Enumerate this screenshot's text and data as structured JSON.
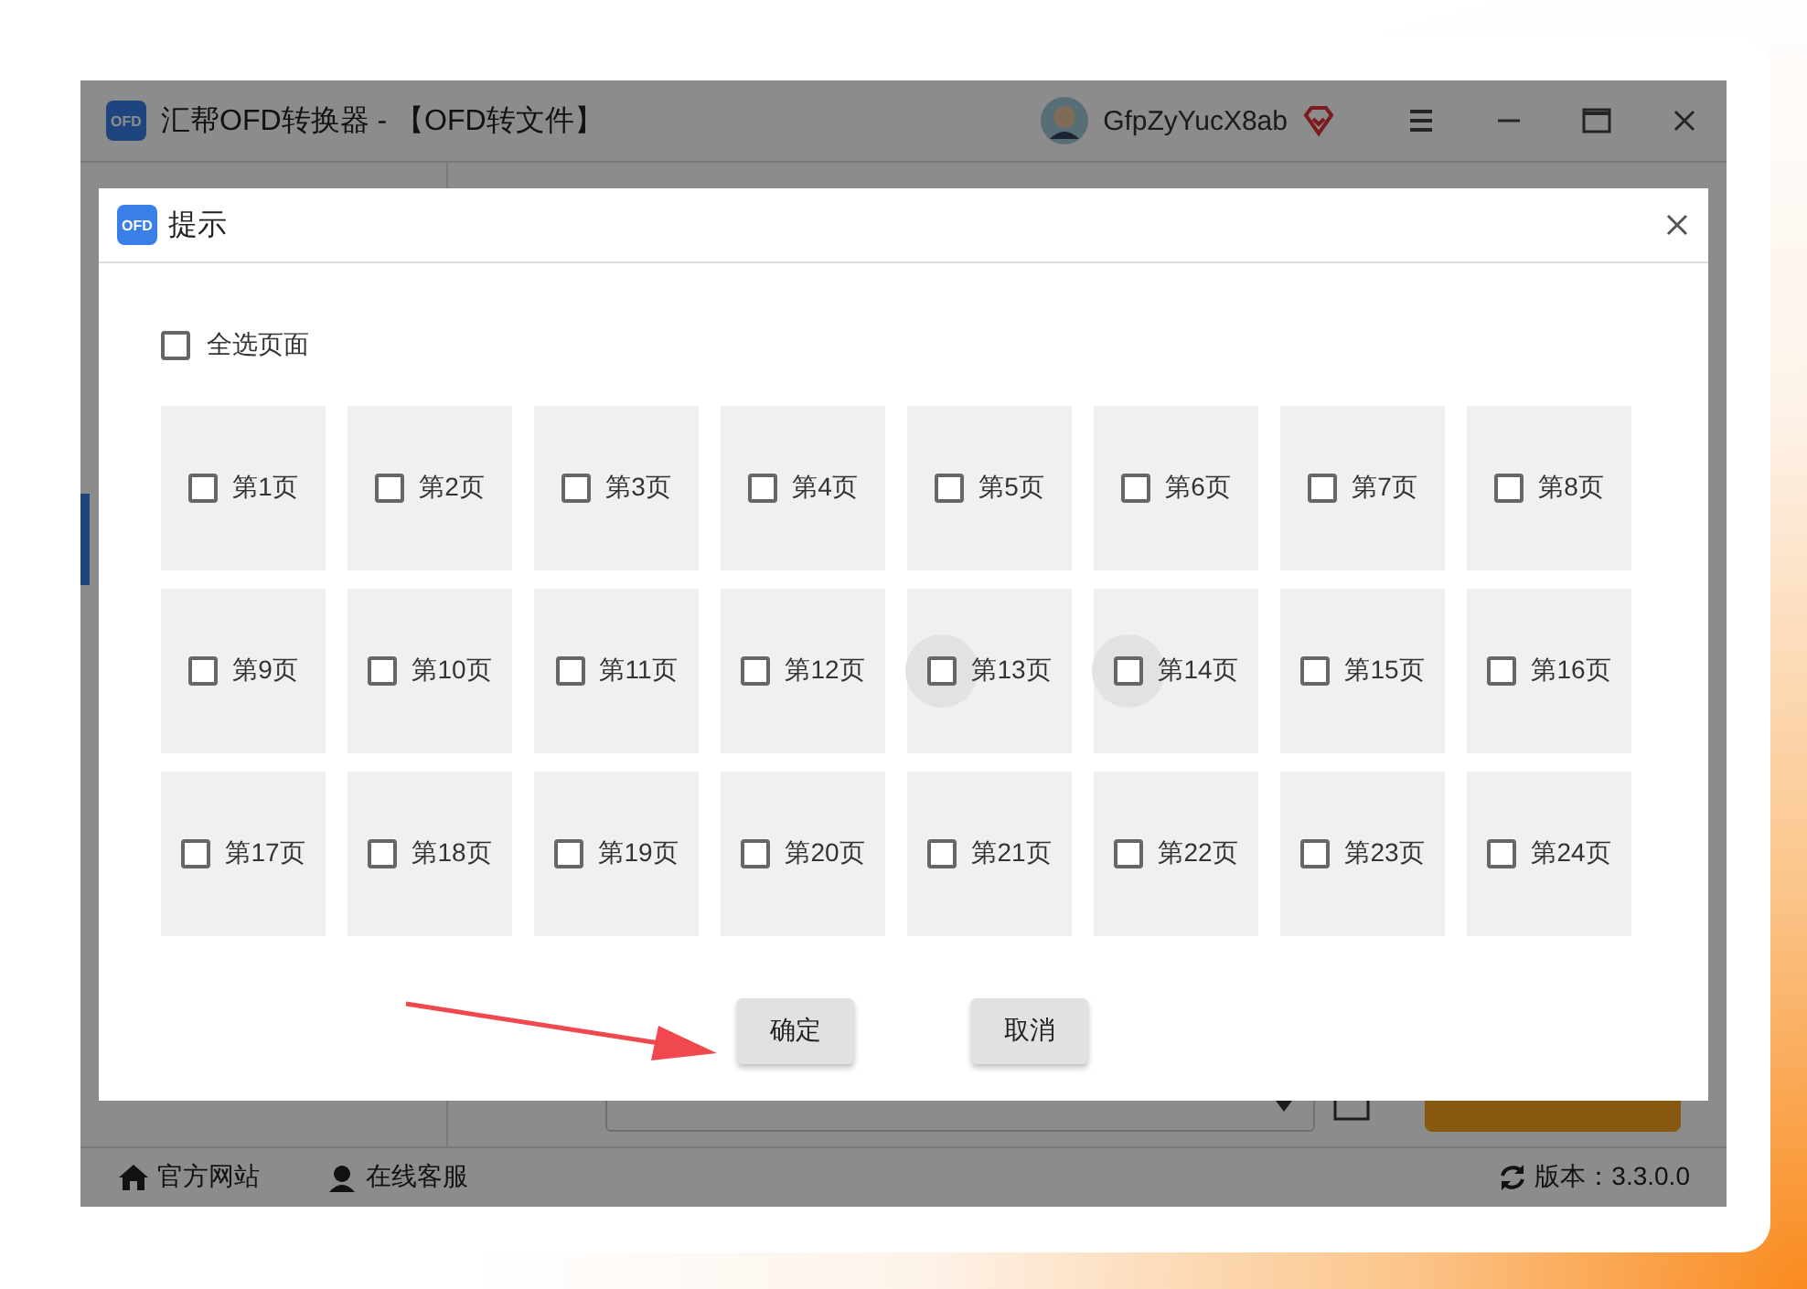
{
  "window": {
    "logo": "OFD",
    "title": "汇帮OFD转换器 - 【OFD转文件】",
    "user": "GfpZyYucX8ab"
  },
  "status_bar": {
    "links": [
      "官方网站",
      "在线客服"
    ],
    "version": "版本：3.3.0.0"
  },
  "dialog": {
    "logo": "OFD",
    "title": "提示",
    "select_all": {
      "label": "全选页面",
      "checked": false
    },
    "pages": [
      {
        "label": "第1页",
        "checked": false,
        "hovered": false
      },
      {
        "label": "第2页",
        "checked": false,
        "hovered": false
      },
      {
        "label": "第3页",
        "checked": false,
        "hovered": false
      },
      {
        "label": "第4页",
        "checked": false,
        "hovered": false
      },
      {
        "label": "第5页",
        "checked": false,
        "hovered": false
      },
      {
        "label": "第6页",
        "checked": false,
        "hovered": false
      },
      {
        "label": "第7页",
        "checked": false,
        "hovered": false
      },
      {
        "label": "第8页",
        "checked": false,
        "hovered": false
      },
      {
        "label": "第9页",
        "checked": false,
        "hovered": false
      },
      {
        "label": "第10页",
        "checked": false,
        "hovered": false
      },
      {
        "label": "第11页",
        "checked": false,
        "hovered": false
      },
      {
        "label": "第12页",
        "checked": false,
        "hovered": false
      },
      {
        "label": "第13页",
        "checked": false,
        "hovered": true
      },
      {
        "label": "第14页",
        "checked": false,
        "hovered": true
      },
      {
        "label": "第15页",
        "checked": false,
        "hovered": false
      },
      {
        "label": "第16页",
        "checked": false,
        "hovered": false
      },
      {
        "label": "第17页",
        "checked": false,
        "hovered": false
      },
      {
        "label": "第18页",
        "checked": false,
        "hovered": false
      },
      {
        "label": "第19页",
        "checked": false,
        "hovered": false
      },
      {
        "label": "第20页",
        "checked": false,
        "hovered": false
      },
      {
        "label": "第21页",
        "checked": false,
        "hovered": false
      },
      {
        "label": "第22页",
        "checked": false,
        "hovered": false
      },
      {
        "label": "第23页",
        "checked": false,
        "hovered": false
      },
      {
        "label": "第24页",
        "checked": false,
        "hovered": false
      }
    ],
    "buttons": [
      "确定",
      "取消"
    ]
  }
}
